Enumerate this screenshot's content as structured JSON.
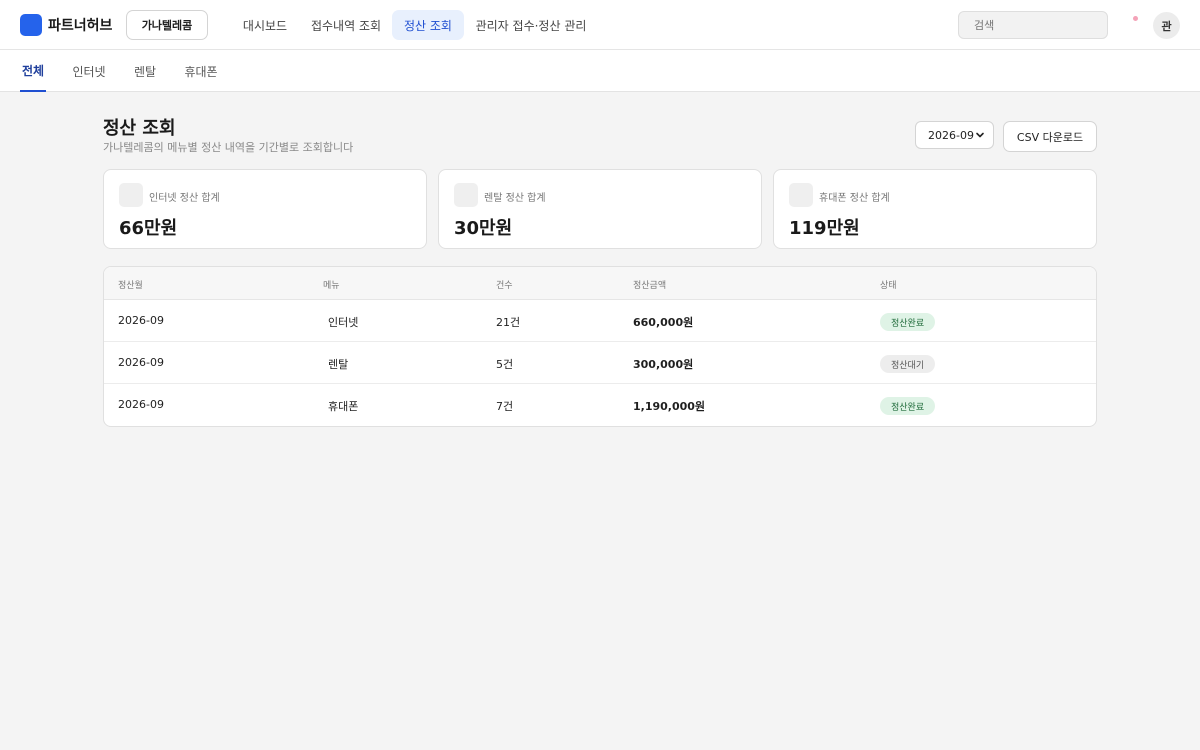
{
  "header": {
    "brand": "파트너허브",
    "company": "가나텔레콤",
    "nav": [
      "대시보드",
      "접수내역 조회",
      "정산 조회",
      "관리자 접수·정산 관리"
    ],
    "active_nav": "정산 조회",
    "search_placeholder": "검색",
    "avatar": "관"
  },
  "subtabs": [
    "전체",
    "인터넷",
    "렌탈",
    "휴대폰"
  ],
  "active_subtab": "전체",
  "page": {
    "title": "정산 조회",
    "subtitle": "가나텔레콤의 메뉴별 정산 내역을 기간별로 조회합니다",
    "month": "2026-09",
    "csv_button": "CSV 다운로드"
  },
  "summary_cards": [
    {
      "label": "인터넷 정산 합계",
      "value": "66만원"
    },
    {
      "label": "렌탈 정산 합계",
      "value": "30만원"
    },
    {
      "label": "휴대폰 정산 합계",
      "value": "119만원"
    }
  ],
  "table": {
    "headers": [
      "정산월",
      "메뉴",
      "건수",
      "정산금액",
      "상태"
    ],
    "rows": [
      {
        "month": "2026-09",
        "menu": "인터넷",
        "count": "21건",
        "amount": "660,000원",
        "status": "정산완료"
      },
      {
        "month": "2026-09",
        "menu": "렌탈",
        "count": "5건",
        "amount": "300,000원",
        "status": "정산대기"
      },
      {
        "month": "2026-09",
        "menu": "휴대폰",
        "count": "7건",
        "amount": "1,190,000원",
        "status": "정산완료"
      }
    ]
  },
  "colors": {
    "accent": "#2563eb",
    "active_nav_bg": "#e8f0fd",
    "status_done_bg": "#dff3e6",
    "status_wait_bg": "#ededed"
  }
}
